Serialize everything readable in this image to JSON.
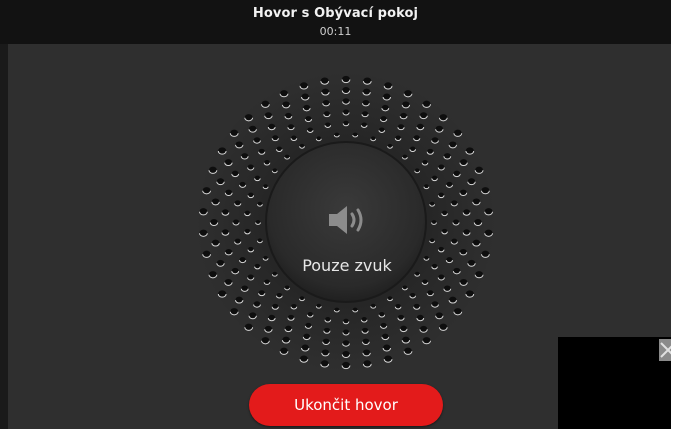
{
  "header": {
    "title": "Hovor s Obývací pokoj",
    "timer": "00:11"
  },
  "call": {
    "mode_label": "Pouze zvuk",
    "mode_icon": "speaker-icon",
    "end_button_label": "Ukončit hovor"
  },
  "colors": {
    "accent": "#e31b1b",
    "background": "#2f2f2f",
    "header": "#121212"
  },
  "video_preview": {
    "close_icon": "close-icon"
  }
}
